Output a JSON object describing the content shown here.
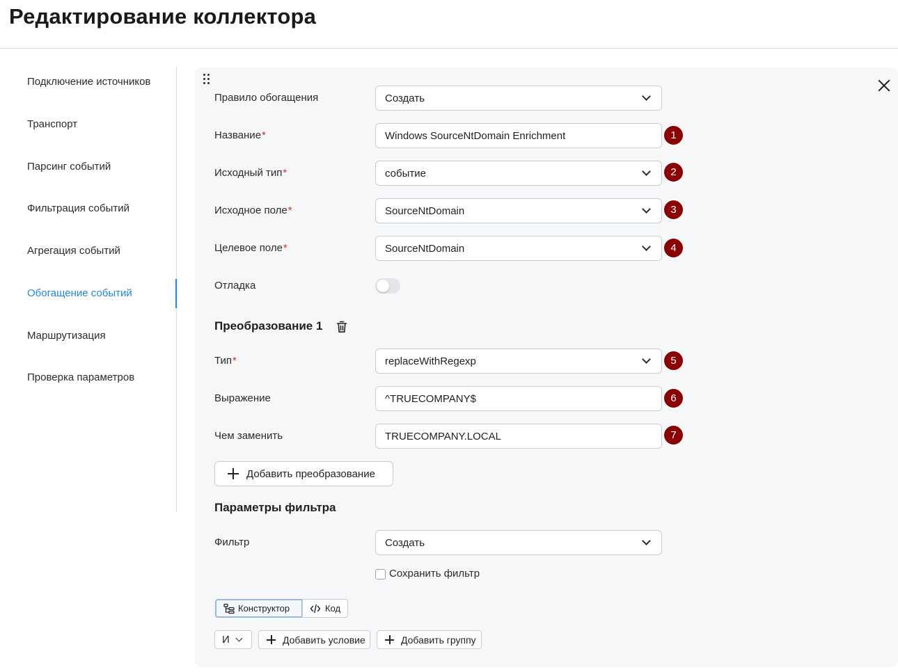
{
  "page": {
    "title": "Редактирование коллектора"
  },
  "sidebar": {
    "items": [
      {
        "label": "Подключение источников"
      },
      {
        "label": "Транспорт"
      },
      {
        "label": "Парсинг событий"
      },
      {
        "label": "Фильтрация событий"
      },
      {
        "label": "Агрегация событий"
      },
      {
        "label": "Обогащение событий",
        "active": true
      },
      {
        "label": "Маршрутизация"
      },
      {
        "label": "Проверка параметров"
      }
    ]
  },
  "form": {
    "required_mark": "*",
    "rule": {
      "label": "Правило обогащения",
      "value": "Создать"
    },
    "name": {
      "label": "Название",
      "value": "Windows SourceNtDomain Enrichment",
      "marker": "1"
    },
    "source_type": {
      "label": "Исходный тип",
      "value": "событие",
      "marker": "2"
    },
    "source_field": {
      "label": "Исходное поле",
      "value": "SourceNtDomain",
      "marker": "3"
    },
    "target_field": {
      "label": "Целевое поле",
      "value": "SourceNtDomain",
      "marker": "4"
    },
    "debug": {
      "label": "Отладка",
      "enabled": false
    }
  },
  "transformation": {
    "title": "Преобразование 1",
    "type": {
      "label": "Тип",
      "value": "replaceWithRegexp",
      "marker": "5"
    },
    "expression": {
      "label": "Выражение",
      "value": "^TRUECOMPANY$",
      "marker": "6"
    },
    "replace_with": {
      "label": "Чем заменить",
      "value": "TRUECOMPANY.LOCAL",
      "marker": "7"
    },
    "add_button": "Добавить преобразование"
  },
  "filter": {
    "title": "Параметры фильтра",
    "filter": {
      "label": "Фильтр",
      "value": "Создать"
    },
    "save_filter": {
      "label": "Сохранить фильтр",
      "checked": false
    },
    "modes": {
      "constructor": "Конструктор",
      "code": "Код",
      "active": "constructor"
    },
    "operator": "И",
    "add_condition": "Добавить условие",
    "add_group": "Добавить группу"
  },
  "colors": {
    "accent": "#1e88e5",
    "marker": "#8b0000",
    "required": "#d32f2f",
    "panel_bg": "#f6f7f9"
  },
  "icons": {
    "drag": "drag-handle-icon",
    "close": "close-icon",
    "chevron": "chevron-down-icon",
    "trash": "trash-icon",
    "plus": "plus-icon",
    "tree": "tree-icon",
    "code": "code-icon"
  }
}
